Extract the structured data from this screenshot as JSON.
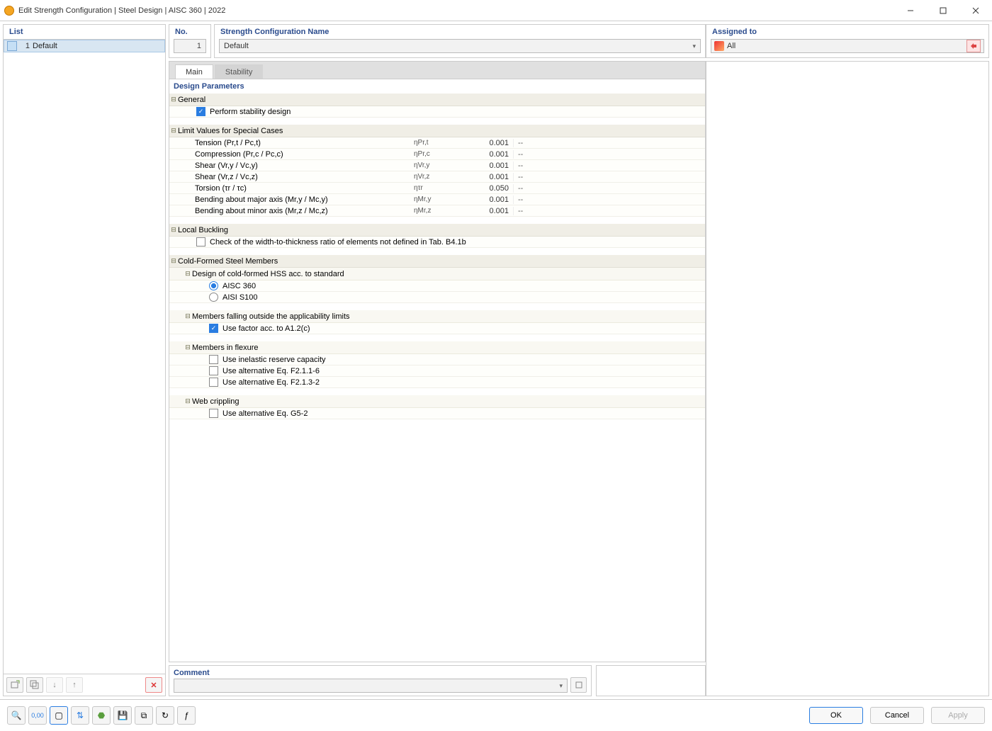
{
  "window": {
    "title": "Edit Strength Configuration | Steel Design | AISC 360 | 2022"
  },
  "list": {
    "header": "List",
    "items": [
      {
        "num": "1",
        "label": "Default"
      }
    ]
  },
  "no": {
    "label": "No.",
    "value": "1"
  },
  "name": {
    "label": "Strength Configuration Name",
    "value": "Default"
  },
  "assigned": {
    "label": "Assigned to",
    "value": "All"
  },
  "tabs": {
    "main": "Main",
    "stability": "Stability"
  },
  "design_params": {
    "title": "Design Parameters"
  },
  "general": {
    "label": "General",
    "perform_stability": "Perform stability design"
  },
  "limit": {
    "label": "Limit Values for Special Cases",
    "rows": [
      {
        "label": "Tension (Pr,t / Pc,t)",
        "symbol": "ηPr,t",
        "value": "0.001",
        "unit": "--"
      },
      {
        "label": "Compression (Pr,c / Pc,c)",
        "symbol": "ηPr,c",
        "value": "0.001",
        "unit": "--"
      },
      {
        "label": "Shear (Vr,y / Vc,y)",
        "symbol": "ηVr,y",
        "value": "0.001",
        "unit": "--"
      },
      {
        "label": "Shear (Vr,z / Vc,z)",
        "symbol": "ηVr,z",
        "value": "0.001",
        "unit": "--"
      },
      {
        "label": "Torsion (τr / τc)",
        "symbol": "ητr",
        "value": "0.050",
        "unit": "--"
      },
      {
        "label": "Bending about major axis (Mr,y / Mc,y)",
        "symbol": "ηMr,y",
        "value": "0.001",
        "unit": "--"
      },
      {
        "label": "Bending about minor axis (Mr,z / Mc,z)",
        "symbol": "ηMr,z",
        "value": "0.001",
        "unit": "--"
      }
    ]
  },
  "local_buckling": {
    "label": "Local Buckling",
    "check": "Check of the width-to-thickness ratio of elements not defined in Tab. B4.1b"
  },
  "cold_formed": {
    "label": "Cold-Formed Steel Members",
    "design_std": {
      "label": "Design of cold-formed HSS acc. to standard",
      "opt1": "AISC 360",
      "opt2": "AISI S100"
    },
    "outside_limits": {
      "label": "Members falling outside the applicability limits",
      "use_factor": "Use factor acc. to A1.2(c)"
    },
    "flexure": {
      "label": "Members in flexure",
      "inelastic": "Use inelastic reserve capacity",
      "alt1": "Use alternative Eq. F2.1.1-6",
      "alt2": "Use alternative Eq. F2.1.3-2"
    },
    "web_crippling": {
      "label": "Web crippling",
      "alt": "Use alternative Eq. G5-2"
    }
  },
  "comment": {
    "label": "Comment"
  },
  "buttons": {
    "ok": "OK",
    "cancel": "Cancel",
    "apply": "Apply"
  }
}
